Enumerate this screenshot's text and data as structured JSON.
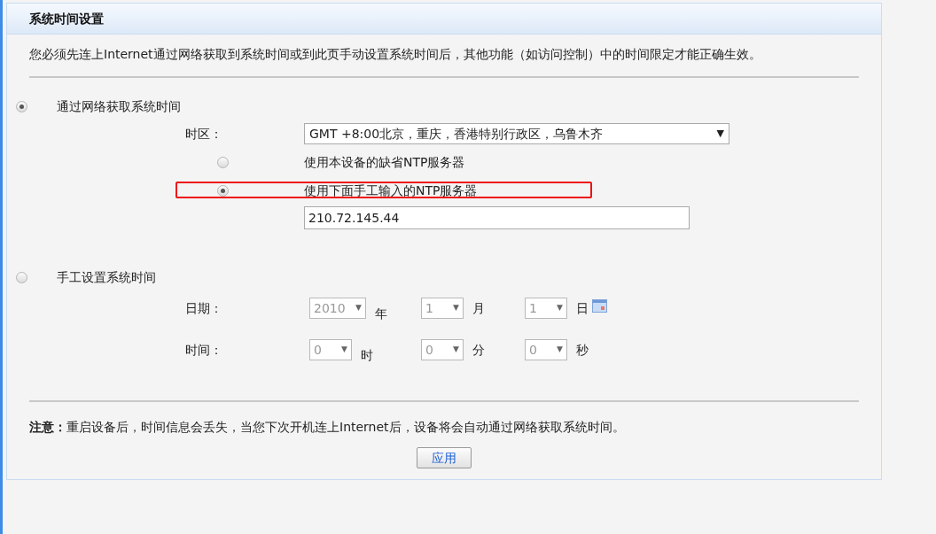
{
  "panel": {
    "title": "系统时间设置",
    "intro": "您必须先连上Internet通过网络获取到系统时间或到此页手动设置系统时间后，其他功能（如访问控制）中的时间限定才能正确生效。",
    "modes": [
      {
        "label": "通过网络获取系统时间",
        "selected": true
      },
      {
        "label": "手工设置系统时间",
        "selected": false
      }
    ],
    "timezone": {
      "label": "时区：",
      "value": "GMT +8:00北京，重庆，香港特别行政区，乌鲁木齐",
      "arrow": "▼"
    },
    "ntp_options": [
      {
        "label": "使用本设备的缺省NTP服务器",
        "selected": false,
        "highlighted": false
      },
      {
        "label": "使用下面手工输入的NTP服务器",
        "selected": true,
        "highlighted": true
      }
    ],
    "ntp_server": "210.72.145.44",
    "manual_rows": [
      {
        "label": "日期：",
        "fields": [
          {
            "value": "2010",
            "unit": "年",
            "disabled": true
          },
          {
            "value": "1",
            "unit": "月",
            "disabled": true
          },
          {
            "value": "1",
            "unit": "日",
            "disabled": true
          }
        ],
        "calendar": true
      },
      {
        "label": "时间：",
        "fields": [
          {
            "value": "0",
            "unit": "时",
            "disabled": true
          },
          {
            "value": "0",
            "unit": "分",
            "disabled": true
          },
          {
            "value": "0",
            "unit": "秒",
            "disabled": true
          }
        ],
        "calendar": false
      }
    ],
    "note": {
      "label": "注意：",
      "text": "重启设备后，时间信息会丢失，当您下次开机连上Internet后，设备将会自动通过网络获取系统时间。"
    },
    "apply_button": "应用"
  }
}
